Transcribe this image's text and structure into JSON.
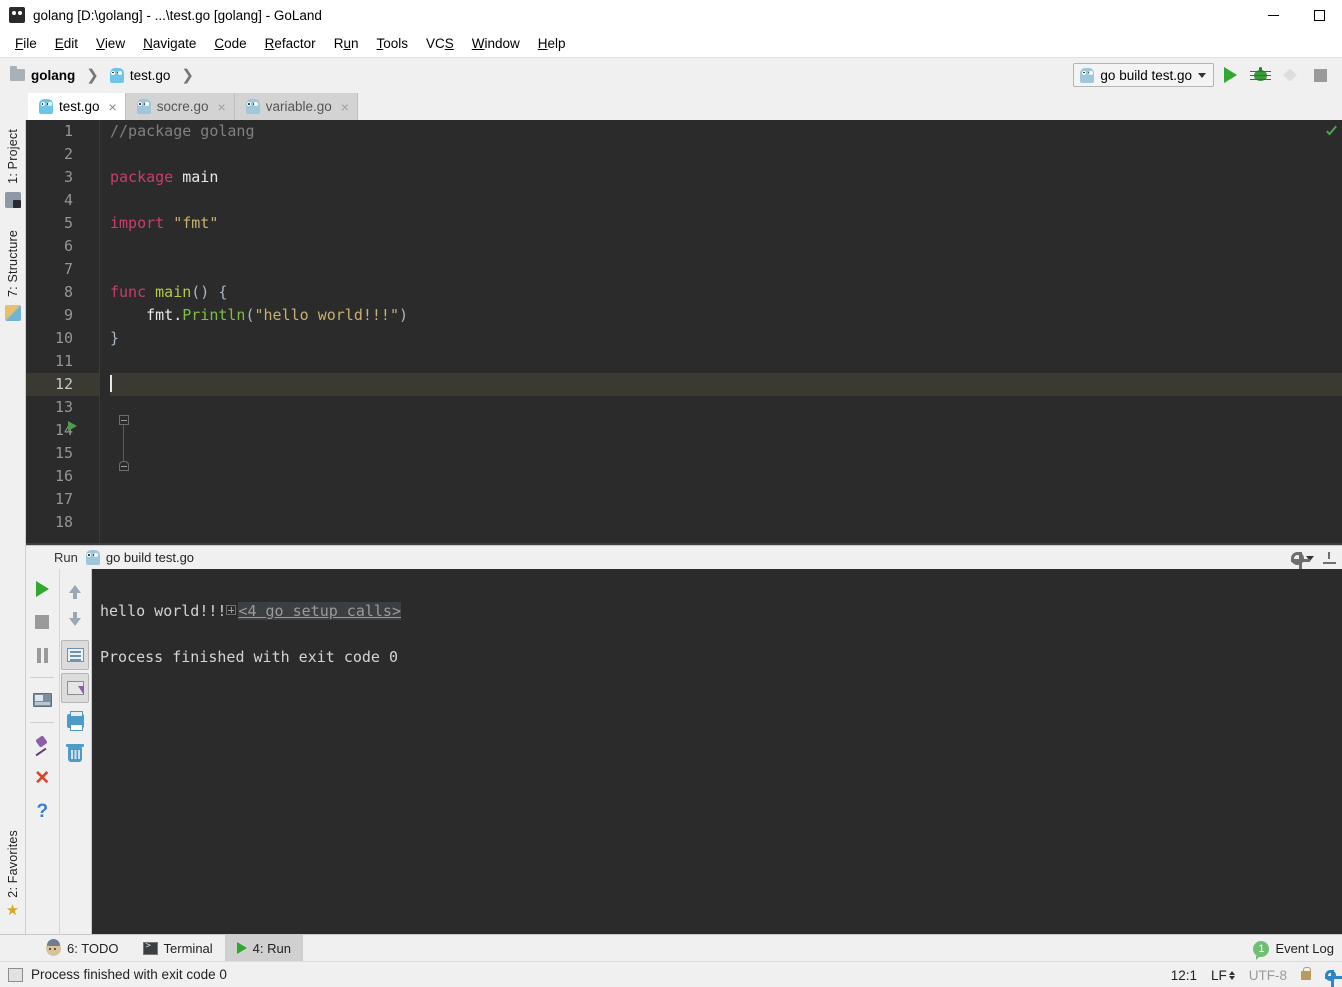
{
  "window": {
    "title": "golang [D:\\golang] - ...\\test.go [golang] - GoLand",
    "app_icon": "goland-icon",
    "minimize_label": "",
    "maximize_label": ""
  },
  "menubar": {
    "items": [
      {
        "label": "File",
        "mnemonic": "F"
      },
      {
        "label": "Edit",
        "mnemonic": "E"
      },
      {
        "label": "View",
        "mnemonic": "V"
      },
      {
        "label": "Navigate",
        "mnemonic": "N"
      },
      {
        "label": "Code",
        "mnemonic": "C"
      },
      {
        "label": "Refactor",
        "mnemonic": "R"
      },
      {
        "label": "Run",
        "mnemonic": "u"
      },
      {
        "label": "Tools",
        "mnemonic": "T"
      },
      {
        "label": "VCS",
        "mnemonic": "S"
      },
      {
        "label": "Window",
        "mnemonic": "W"
      },
      {
        "label": "Help",
        "mnemonic": "H"
      }
    ]
  },
  "navbar": {
    "breadcrumbs": [
      {
        "label": "golang",
        "icon": "folder-icon",
        "bold": true
      },
      {
        "label": "test.go",
        "icon": "go-file-icon",
        "bold": false
      }
    ],
    "run_config": {
      "label": "go build test.go",
      "icon": "go-file-icon",
      "dropdown": "chevron-down-icon"
    },
    "buttons": [
      {
        "name": "run-button",
        "icon": "play-icon",
        "enabled": true
      },
      {
        "name": "debug-button",
        "icon": "bug-icon",
        "enabled": true
      },
      {
        "name": "run-with-coverage-button",
        "icon": "coverage-icon",
        "enabled": false
      },
      {
        "name": "stop-button",
        "icon": "stop-icon",
        "enabled": true
      }
    ]
  },
  "editor_tabs": [
    {
      "label": "test.go",
      "icon": "go-file-icon",
      "active": true,
      "close": "×"
    },
    {
      "label": "socre.go",
      "icon": "go-file-icon",
      "active": false,
      "close": "×"
    },
    {
      "label": "variable.go",
      "icon": "go-file-icon",
      "active": false,
      "close": "×"
    }
  ],
  "left_rail": {
    "top": [
      {
        "label": "1: Project",
        "mnemonic": "1",
        "icon": "project-icon"
      },
      {
        "label": "7: Structure",
        "mnemonic": "7",
        "icon": "structure-icon"
      }
    ],
    "bottom": [
      {
        "label": "2: Favorites",
        "mnemonic": "2",
        "icon": "star-icon"
      }
    ]
  },
  "editor": {
    "language": "go",
    "current_line": 12,
    "line_numbers": [
      1,
      2,
      3,
      4,
      5,
      6,
      7,
      8,
      9,
      10,
      11,
      12,
      13,
      14,
      15,
      16,
      17,
      18
    ],
    "lines": [
      {
        "n": 1,
        "tokens": [
          {
            "t": "//package golang",
            "c": "c-comment"
          }
        ]
      },
      {
        "n": 2,
        "tokens": []
      },
      {
        "n": 3,
        "tokens": [
          {
            "t": "package",
            "c": "c-kw"
          },
          {
            "t": " ",
            "c": "c-punct"
          },
          {
            "t": "main",
            "c": "c-ident"
          }
        ]
      },
      {
        "n": 4,
        "tokens": []
      },
      {
        "n": 5,
        "tokens": [
          {
            "t": "import",
            "c": "c-kw"
          },
          {
            "t": " ",
            "c": "c-punct"
          },
          {
            "t": "\"fmt\"",
            "c": "c-str"
          }
        ]
      },
      {
        "n": 6,
        "tokens": []
      },
      {
        "n": 7,
        "tokens": []
      },
      {
        "n": 8,
        "tokens": [
          {
            "t": "func",
            "c": "c-kw"
          },
          {
            "t": " ",
            "c": "c-punct"
          },
          {
            "t": "main",
            "c": "c-func-nm"
          },
          {
            "t": "() {",
            "c": "c-punct"
          }
        ]
      },
      {
        "n": 9,
        "tokens": [
          {
            "t": "    fmt.",
            "c": "c-ident"
          },
          {
            "t": "Println",
            "c": "c-fn"
          },
          {
            "t": "(",
            "c": "c-punct"
          },
          {
            "t": "\"hello world!!!\"",
            "c": "c-str"
          },
          {
            "t": ")",
            "c": "c-punct"
          }
        ]
      },
      {
        "n": 10,
        "tokens": [
          {
            "t": "}",
            "c": "c-punct"
          }
        ]
      },
      {
        "n": 11,
        "tokens": []
      },
      {
        "n": 12,
        "tokens": [],
        "caret": true
      },
      {
        "n": 13,
        "tokens": []
      },
      {
        "n": 14,
        "tokens": []
      },
      {
        "n": 15,
        "tokens": []
      },
      {
        "n": 16,
        "tokens": []
      },
      {
        "n": 17,
        "tokens": []
      },
      {
        "n": 18,
        "tokens": []
      }
    ],
    "gutter_run_marker_line": 8,
    "fold_start_line": 8,
    "fold_end_line": 10,
    "inspection_status": "ok-check-icon"
  },
  "run_window": {
    "title": "Run",
    "tab_label": "go build test.go",
    "tab_icon": "go-file-icon",
    "settings_icon": "gear-icon",
    "hide_icon": "hide-icon",
    "left_toolbar": [
      {
        "name": "rerun-button",
        "icon": "play-icon",
        "enabled": true
      },
      {
        "name": "stop-button",
        "icon": "stop-icon",
        "enabled": false
      },
      {
        "name": "pause-output-button",
        "icon": "pause-icon",
        "enabled": false
      },
      {
        "name": "dump-threads-button",
        "icon": "monitor-icon",
        "enabled": true
      },
      {
        "name": "pin-tab-button",
        "icon": "pin-icon",
        "enabled": true
      },
      {
        "name": "close-button",
        "icon": "close-x-icon",
        "enabled": true
      },
      {
        "name": "help-button",
        "icon": "question-icon",
        "enabled": true
      }
    ],
    "right_toolbar": [
      {
        "name": "previous-occurrence-button",
        "icon": "arrow-up-icon",
        "selected": false
      },
      {
        "name": "next-occurrence-button",
        "icon": "arrow-down-icon",
        "selected": false
      },
      {
        "name": "soft-wrap-button",
        "icon": "soft-wrap-icon",
        "selected": true
      },
      {
        "name": "scroll-to-end-button",
        "icon": "scroll-to-end-icon",
        "selected": true
      },
      {
        "name": "print-button",
        "icon": "printer-icon",
        "selected": false
      },
      {
        "name": "clear-all-button",
        "icon": "trash-icon",
        "selected": false
      }
    ],
    "console": {
      "fold_label": "<4 go setup calls>",
      "fold_expand": "plus-icon",
      "lines": [
        "hello world!!!",
        "",
        "Process finished with exit code 0"
      ]
    }
  },
  "bottom_bar": {
    "tabs": [
      {
        "label": "6: TODO",
        "mnemonic": "6",
        "icon": "todo-icon",
        "active": false
      },
      {
        "label": "Terminal",
        "mnemonic": "",
        "icon": "terminal-icon",
        "active": false
      },
      {
        "label": "4: Run",
        "mnemonic": "4",
        "icon": "play-icon",
        "active": true
      }
    ],
    "event_log": {
      "label": "Event Log",
      "badge": "1",
      "badge_color": "#6fbf73"
    }
  },
  "status_bar": {
    "icon": "console-icon",
    "message": "Process finished with exit code 0",
    "caret_position": "12:1",
    "line_separator": "LF",
    "encoding": "UTF-8",
    "lock_icon": "lock-icon",
    "settings_icon": "gear-icon"
  },
  "colors": {
    "editor_bg": "#2b2b2b",
    "current_line": "#3a3a32",
    "keyword": "#cc3b6e",
    "string": "#c9b072",
    "function": "#7fbf3f",
    "comment": "#808080",
    "accent_green": "#2fa82f",
    "chrome_bg": "#f0f0f0"
  }
}
